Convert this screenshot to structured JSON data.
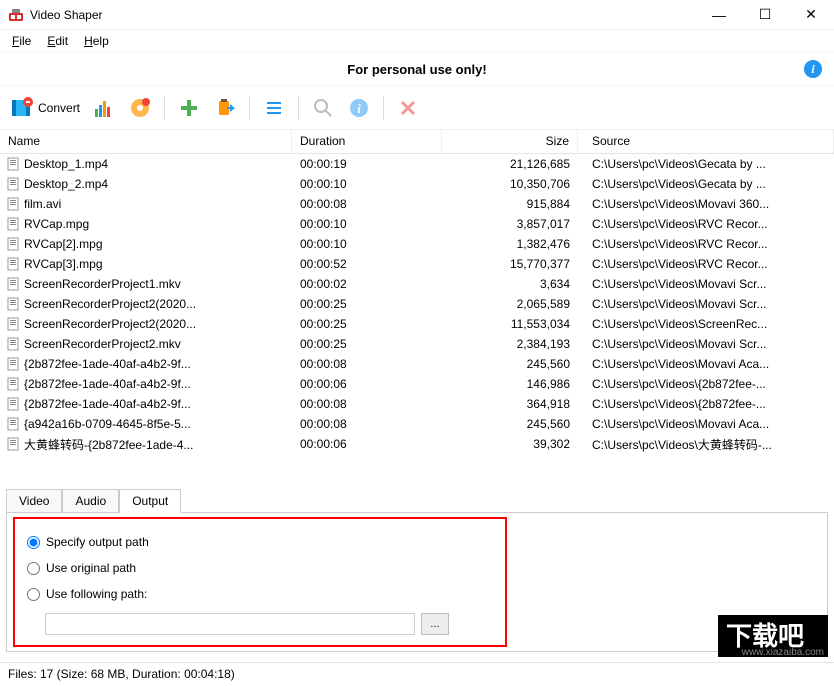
{
  "window": {
    "title": "Video Shaper"
  },
  "menu": {
    "file": "File",
    "edit": "Edit",
    "help": "Help"
  },
  "banner": {
    "text": "For personal use only!"
  },
  "toolbar": {
    "convert": "Convert"
  },
  "columns": {
    "name": "Name",
    "duration": "Duration",
    "size": "Size",
    "source": "Source"
  },
  "files": [
    {
      "name": "Desktop_1.mp4",
      "duration": "00:00:19",
      "size": "21,126,685",
      "source": "C:\\Users\\pc\\Videos\\Gecata by ..."
    },
    {
      "name": "Desktop_2.mp4",
      "duration": "00:00:10",
      "size": "10,350,706",
      "source": "C:\\Users\\pc\\Videos\\Gecata by ..."
    },
    {
      "name": "film.avi",
      "duration": "00:00:08",
      "size": "915,884",
      "source": "C:\\Users\\pc\\Videos\\Movavi 360..."
    },
    {
      "name": "RVCap.mpg",
      "duration": "00:00:10",
      "size": "3,857,017",
      "source": "C:\\Users\\pc\\Videos\\RVC Recor..."
    },
    {
      "name": "RVCap[2].mpg",
      "duration": "00:00:10",
      "size": "1,382,476",
      "source": "C:\\Users\\pc\\Videos\\RVC Recor..."
    },
    {
      "name": "RVCap[3].mpg",
      "duration": "00:00:52",
      "size": "15,770,377",
      "source": "C:\\Users\\pc\\Videos\\RVC Recor..."
    },
    {
      "name": "ScreenRecorderProject1.mkv",
      "duration": "00:00:02",
      "size": "3,634",
      "source": "C:\\Users\\pc\\Videos\\Movavi Scr..."
    },
    {
      "name": "ScreenRecorderProject2(2020...",
      "duration": "00:00:25",
      "size": "2,065,589",
      "source": "C:\\Users\\pc\\Videos\\Movavi Scr..."
    },
    {
      "name": "ScreenRecorderProject2(2020...",
      "duration": "00:00:25",
      "size": "11,553,034",
      "source": "C:\\Users\\pc\\Videos\\ScreenRec..."
    },
    {
      "name": "ScreenRecorderProject2.mkv",
      "duration": "00:00:25",
      "size": "2,384,193",
      "source": "C:\\Users\\pc\\Videos\\Movavi Scr..."
    },
    {
      "name": "{2b872fee-1ade-40af-a4b2-9f...",
      "duration": "00:00:08",
      "size": "245,560",
      "source": "C:\\Users\\pc\\Videos\\Movavi Aca..."
    },
    {
      "name": "{2b872fee-1ade-40af-a4b2-9f...",
      "duration": "00:00:06",
      "size": "146,986",
      "source": "C:\\Users\\pc\\Videos\\{2b872fee-..."
    },
    {
      "name": "{2b872fee-1ade-40af-a4b2-9f...",
      "duration": "00:00:08",
      "size": "364,918",
      "source": "C:\\Users\\pc\\Videos\\{2b872fee-..."
    },
    {
      "name": "{a942a16b-0709-4645-8f5e-5...",
      "duration": "00:00:08",
      "size": "245,560",
      "source": "C:\\Users\\pc\\Videos\\Movavi Aca..."
    },
    {
      "name": "大黄蜂转码-{2b872fee-1ade-4...",
      "duration": "00:00:06",
      "size": "39,302",
      "source": "C:\\Users\\pc\\Videos\\大黄蜂转码-..."
    }
  ],
  "tabs": {
    "video": "Video",
    "audio": "Audio",
    "output": "Output"
  },
  "output": {
    "specify": "Specify output path",
    "original": "Use original path",
    "following": "Use following path:",
    "browse": "...",
    "path_value": ""
  },
  "status": {
    "text": "Files: 17 (Size: 68 MB, Duration: 00:04:18)"
  },
  "watermark": {
    "url": "www.xiazaiba.com"
  }
}
